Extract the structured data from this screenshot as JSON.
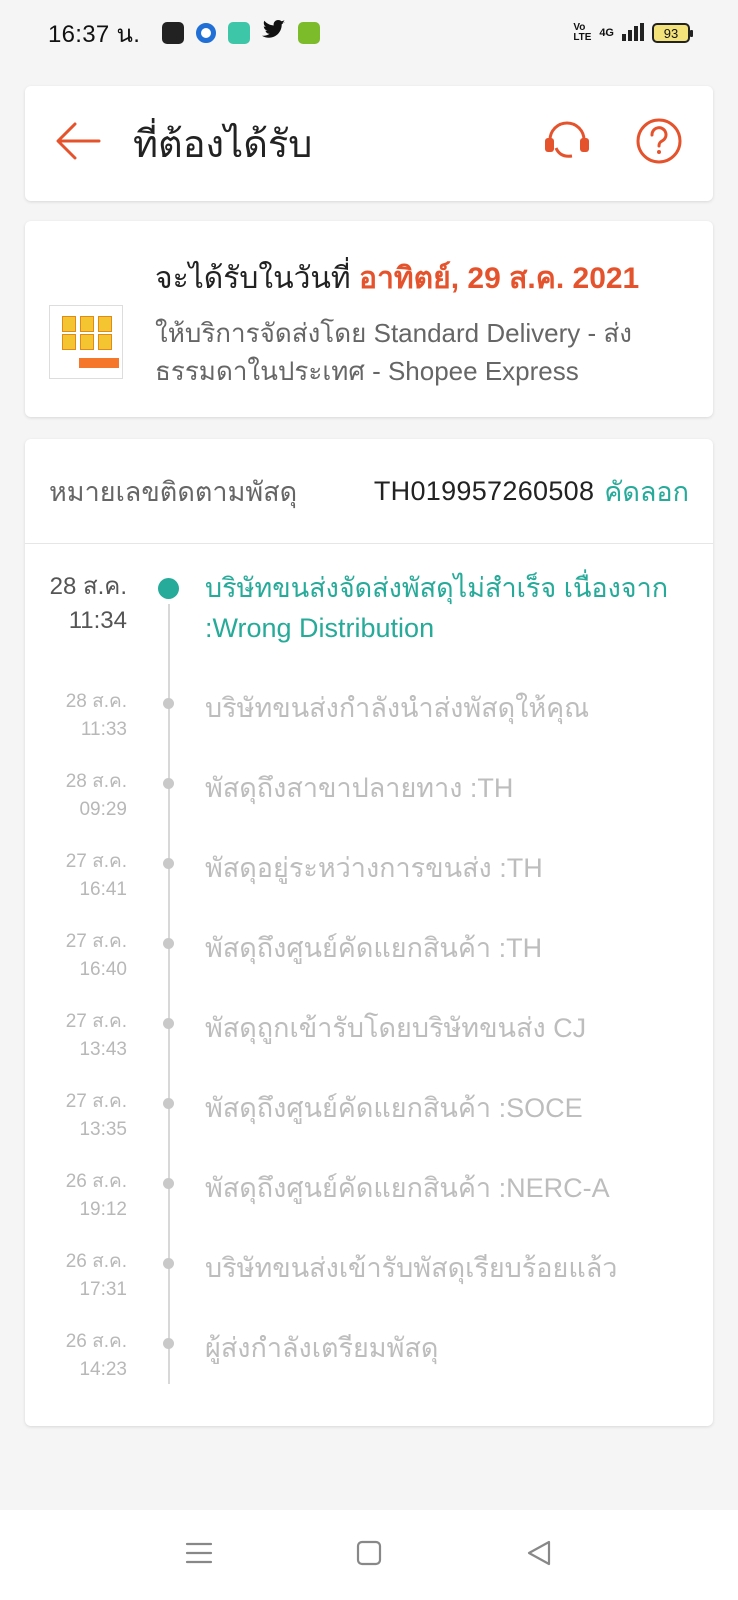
{
  "status_bar": {
    "time": "16:37 น.",
    "network": "4G",
    "volte": "Vo LTE",
    "battery": "93"
  },
  "header": {
    "title": "ที่ต้องได้รับ",
    "accent_color": "#e5532d"
  },
  "delivery": {
    "label": "จะได้รับในวันที่",
    "date": "อาทิตย์, 29 ส.ค. 2021",
    "service": "ให้บริการจัดส่งโดย Standard Delivery - ส่งธรรมดาในประเทศ - Shopee Express"
  },
  "tracking": {
    "label": "หมายเลขติดตามพัสดุ",
    "number": "TH019957260508",
    "copy_label": "คัดลอก",
    "highlight_color": "#26aa99"
  },
  "events": [
    {
      "date": "28 ส.ค.",
      "time": "11:34",
      "desc": "บริษัทขนส่งจัดส่งพัสดุไม่สำเร็จ เนื่องจาก :Wrong Distribution"
    },
    {
      "date": "28 ส.ค.",
      "time": "11:33",
      "desc": "บริษัทขนส่งกำลังนำส่งพัสดุให้คุณ"
    },
    {
      "date": "28 ส.ค.",
      "time": "09:29",
      "desc": "พัสดุถึงสาขาปลายทาง :TH"
    },
    {
      "date": "27 ส.ค.",
      "time": "16:41",
      "desc": "พัสดุอยู่ระหว่างการขนส่ง :TH"
    },
    {
      "date": "27 ส.ค.",
      "time": "16:40",
      "desc": "พัสดุถึงศูนย์คัดแยกสินค้า :TH"
    },
    {
      "date": "27 ส.ค.",
      "time": "13:43",
      "desc": "พัสดุถูกเข้ารับโดยบริษัทขนส่ง CJ"
    },
    {
      "date": "27 ส.ค.",
      "time": "13:35",
      "desc": "พัสดุถึงศูนย์คัดแยกสินค้า :SOCE"
    },
    {
      "date": "26 ส.ค.",
      "time": "19:12",
      "desc": "พัสดุถึงศูนย์คัดแยกสินค้า :NERC-A"
    },
    {
      "date": "26 ส.ค.",
      "time": "17:31",
      "desc": "บริษัทขนส่งเข้ารับพัสดุเรียบร้อยแล้ว"
    },
    {
      "date": "26 ส.ค.",
      "time": "14:23",
      "desc": "ผู้ส่งกำลังเตรียมพัสดุ"
    }
  ],
  "icons": {
    "back": "arrow-left-icon",
    "support": "headset-icon",
    "help": "question-circle-icon",
    "menu": "menu-icon",
    "home": "home-square-icon",
    "back_nav": "triangle-back-icon"
  }
}
